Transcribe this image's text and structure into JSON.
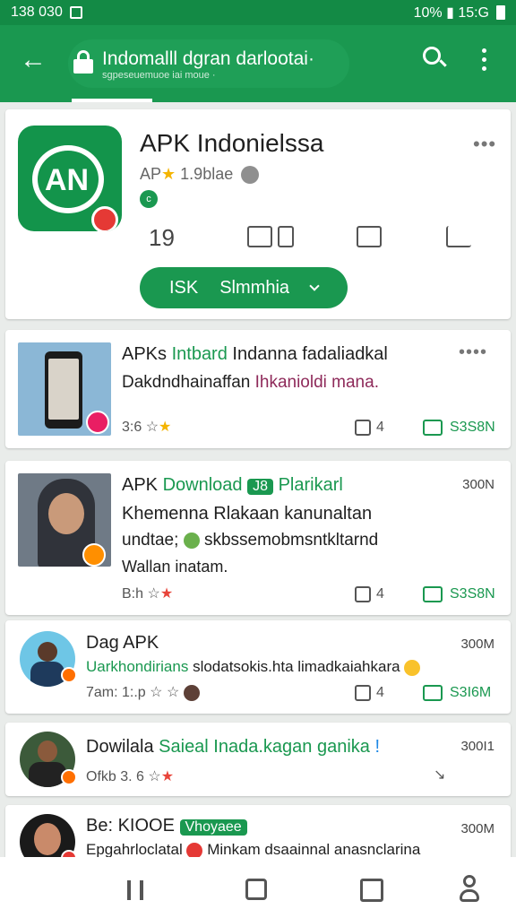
{
  "status_bar": {
    "time": "138 030",
    "right_text": "10% ▮ 15:G"
  },
  "app_bar": {
    "title": "Indomalll dgran darlootai·",
    "subtitle": "sgpeseuemuoe iai moue ·"
  },
  "app_header": {
    "title": "APK Indonielssa",
    "developer": "AP",
    "rating": "1.9blae",
    "small_badge": "c",
    "count": "19",
    "install_label": "ISK",
    "install_option": "Slmmhia"
  },
  "cards": [
    {
      "title_1": "APKs ",
      "title_green": "Intbard",
      "title_2": " Indanna fadaliadkal",
      "line2_1": "Dakdndhainaffan ",
      "line2_maroon": "Ihkanioldi mana.",
      "meta": "3:6",
      "likes": "4",
      "size_right": "S3S8N"
    },
    {
      "title_1": "APK ",
      "title_green": "Download",
      "tag": "J8",
      "title_green_2": "Plarikarl",
      "size": "300N",
      "line2": "Khemenna Rlakaan kanunaltan",
      "line3": "undtae; ",
      "line3_b": " skbssemobmsntkltarnd",
      "line4": "Wallan inatam.",
      "meta": "B:h",
      "likes": "4",
      "size_right": "S3S8N"
    },
    {
      "title_1": "Dag APK",
      "size": "300M",
      "line2_green": "Uarkhondirians",
      "line2_rest": " slodatsokis.hta limadkaiahkara",
      "meta": "7am: 1:.p ",
      "likes": "4",
      "size_right": "S3I6M"
    },
    {
      "title_1": "Dowilala ",
      "title_green": "Saieal Inada.kagan ganika",
      "size": "300I1",
      "meta": "Ofkb 3. 6"
    },
    {
      "title_1": "Be: KIOOE",
      "tag": "Vhoyaee",
      "size": "300M",
      "line2_1": "Epgahrloclatal ",
      "line2_2": " Minkam dsaainnal anasnclarina"
    }
  ]
}
